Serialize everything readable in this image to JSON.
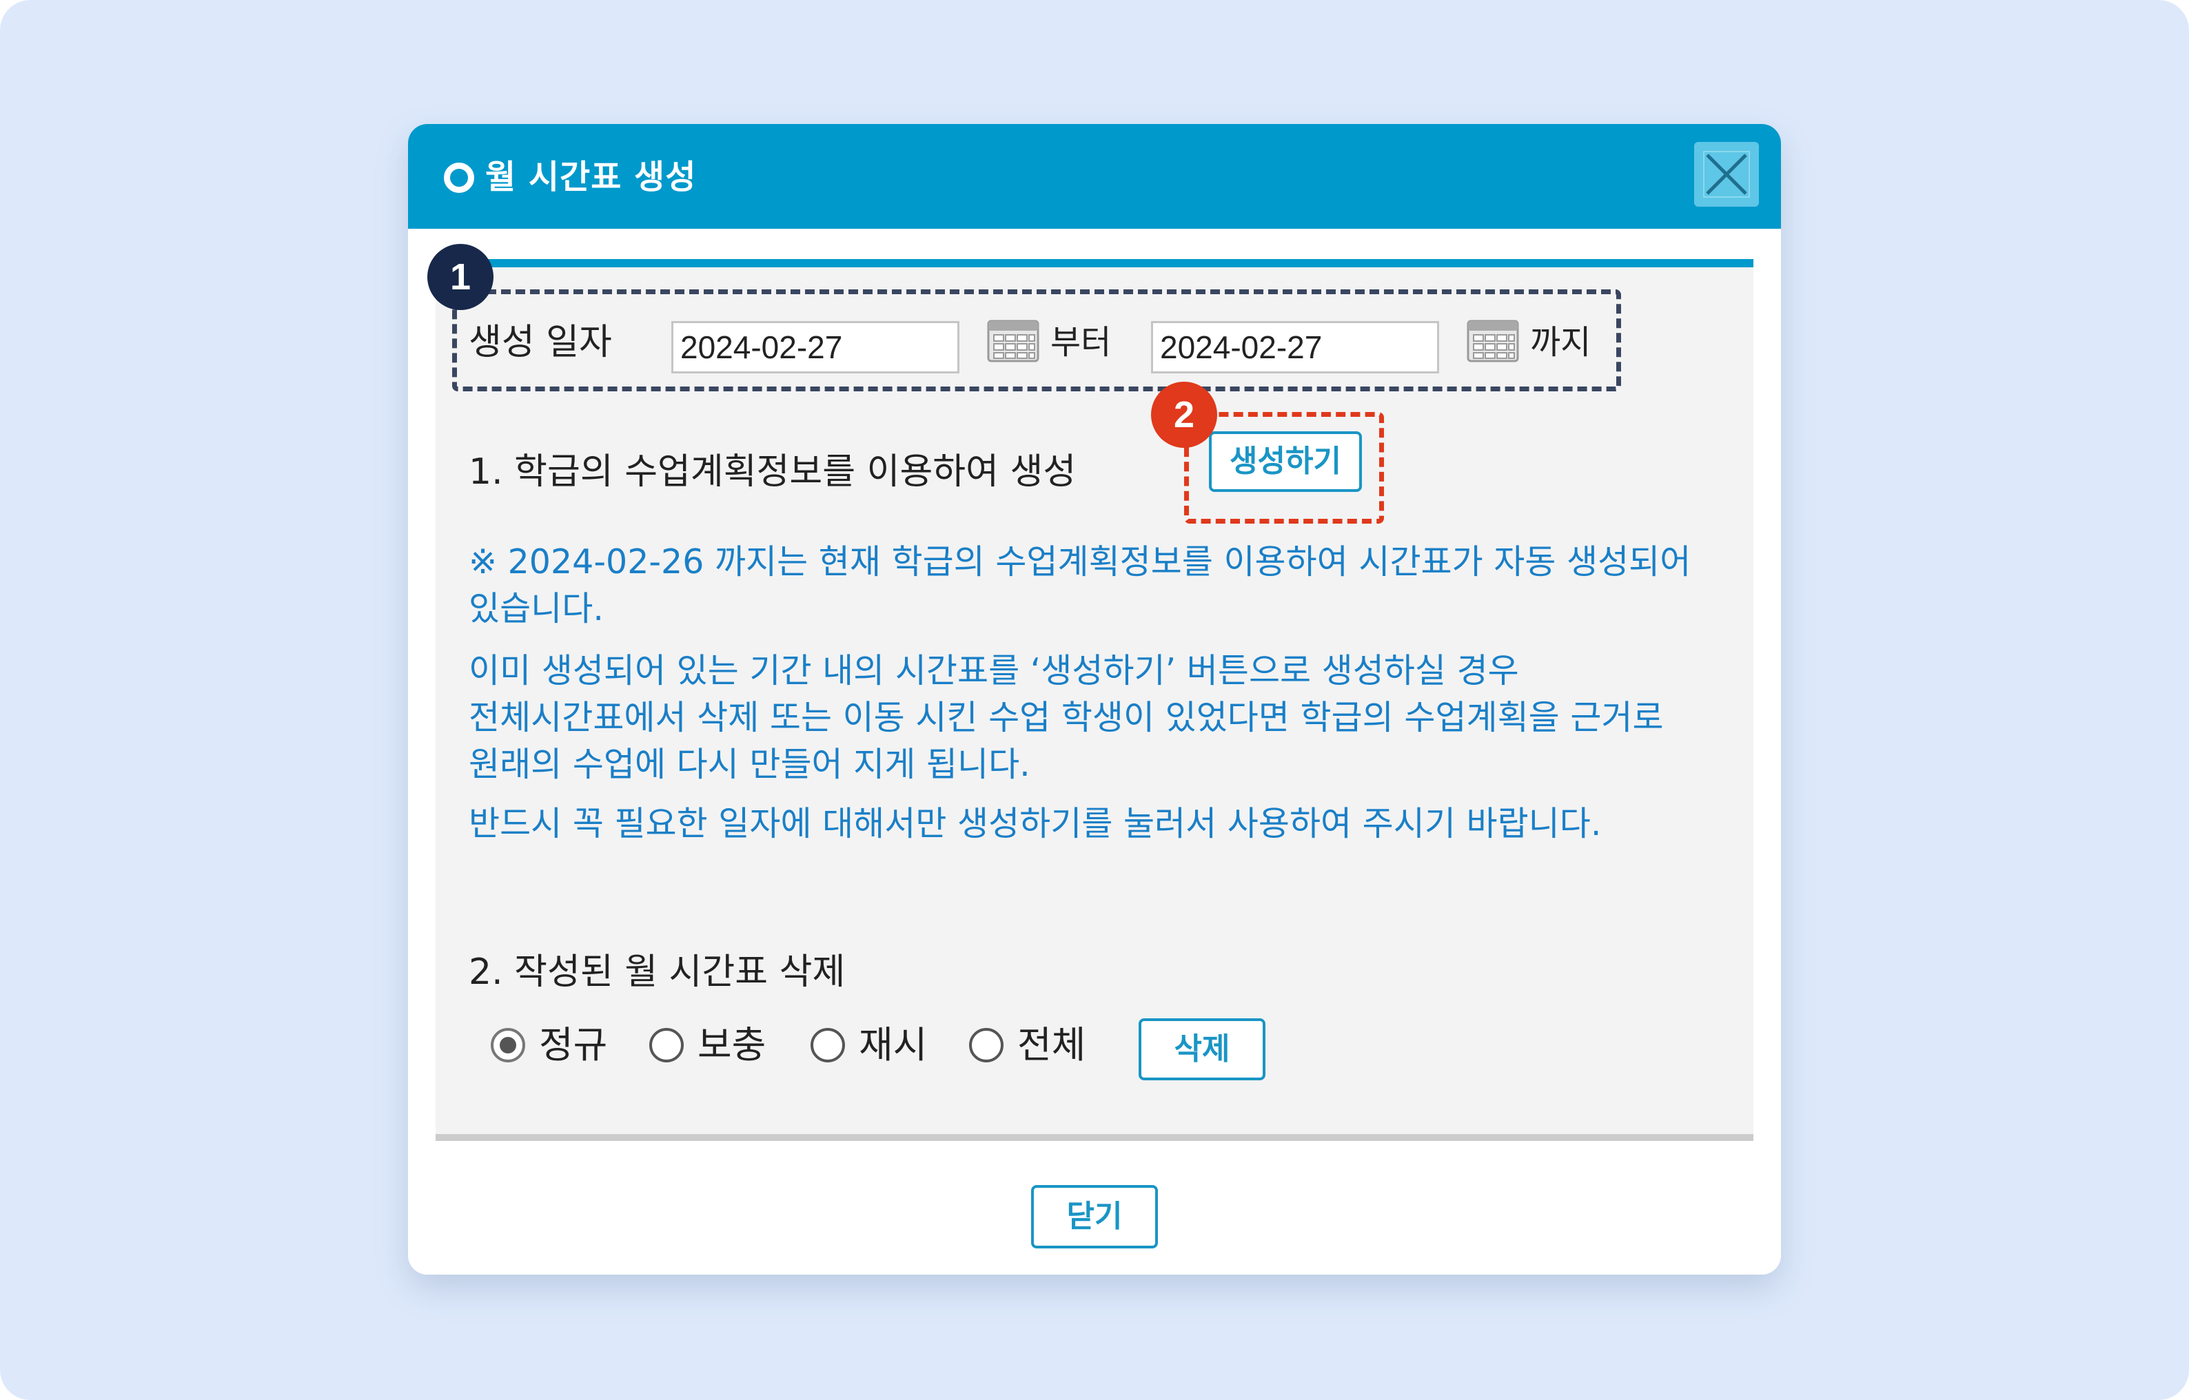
{
  "dialog": {
    "title": "월 시간표 생성",
    "close_icon": "close-x-icon"
  },
  "markers": {
    "one": "1",
    "two": "2"
  },
  "date_range": {
    "label": "생성 일자",
    "start_date": "2024-02-27",
    "from_label": "부터",
    "end_date": "2024-02-27",
    "to_label": "까지",
    "calendar_icon": "calendar-icon"
  },
  "section1": {
    "heading": "1. 학급의 수업계획정보를 이용하여 생성",
    "create_button": "생성하기",
    "notices": [
      "※ 2024-02-26 까지는 현재 학급의 수업계획정보를 이용하여 시간표가 자동 생성되어 있습니다.",
      "이미 생성되어 있는 기간 내의 시간표를 ‘생성하기’ 버튼으로 생성하실 경우 전체시간표에서 삭제 또는 이동 시킨 수업 학생이 있었다면 학급의 수업계획을 근거로 원래의 수업에 다시 만들어 지게 됩니다.",
      "반드시 꼭 필요한 일자에 대해서만 생성하기를 눌러서 사용하여 주시기 바랍니다."
    ]
  },
  "section2": {
    "heading": "2. 작성된 월 시간표 삭제",
    "options": [
      "정규",
      "보충",
      "재시",
      "전체"
    ],
    "selected": "정규",
    "delete_button": "삭제"
  },
  "footer": {
    "close_button": "닫기"
  },
  "colors": {
    "titlebar": "#0099cc",
    "notice_text": "#1a7fc7",
    "marker_dark": "#17284a",
    "marker_red": "#e0391b",
    "background": "#dde9fb"
  }
}
